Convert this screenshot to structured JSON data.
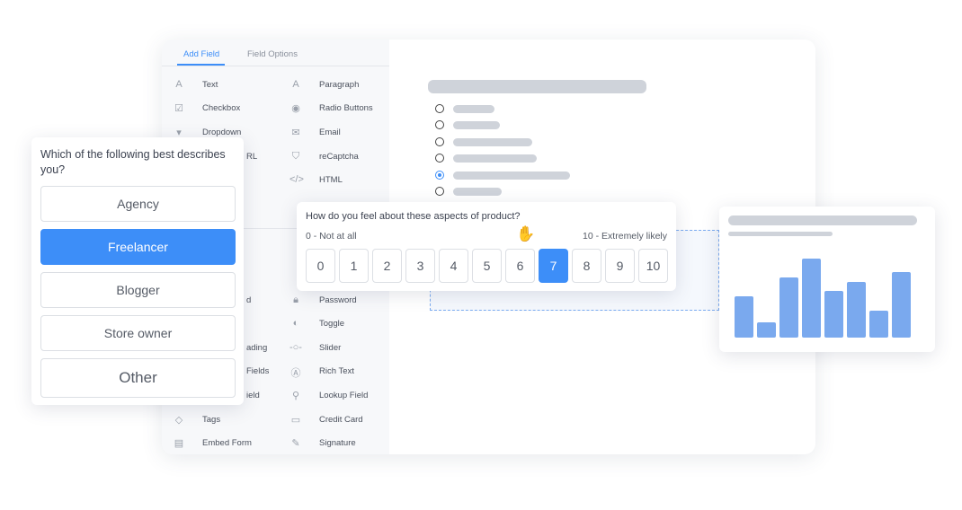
{
  "builder": {
    "tabs": [
      {
        "label": "Add Field",
        "active": true
      },
      {
        "label": "Field Options",
        "active": false
      }
    ],
    "left_fields": [
      {
        "label": "Text",
        "icon": "text-icon"
      },
      {
        "label": "Checkbox",
        "icon": "checkbox-icon"
      },
      {
        "label": "Dropdown",
        "icon": "dropdown-icon"
      },
      {
        "label": "RL"
      },
      {
        "label": "d"
      },
      {
        "label": "ading"
      },
      {
        "label": "Fields"
      },
      {
        "label": "ield"
      },
      {
        "label": "Tags",
        "icon": "tag-icon"
      },
      {
        "label": "Embed Form",
        "icon": "document-icon"
      }
    ],
    "right_fields": [
      {
        "label": "Paragraph",
        "icon": "paragraph-icon"
      },
      {
        "label": "Radio Buttons",
        "icon": "radio-icon"
      },
      {
        "label": "Email",
        "icon": "email-icon"
      },
      {
        "label": "reCaptcha",
        "icon": "shield-icon"
      },
      {
        "label": "HTML",
        "icon": "code-icon"
      },
      {
        "label": "Password",
        "icon": "lock-icon"
      },
      {
        "label": "Toggle",
        "icon": "toggle-icon"
      },
      {
        "label": "Slider",
        "icon": "slider-icon"
      },
      {
        "label": "Rich Text",
        "icon": "rich-text-icon"
      },
      {
        "label": "Lookup Field",
        "icon": "search-icon"
      },
      {
        "label": "Credit Card",
        "icon": "credit-card-icon"
      },
      {
        "label": "Signature",
        "icon": "pen-icon"
      }
    ],
    "preview_radio_selected_index": 4
  },
  "question_card": {
    "title": "Which of the following best describes you?",
    "options": [
      "Agency",
      "Freelancer",
      "Blogger",
      "Store owner",
      "Other"
    ],
    "selected": "Freelancer"
  },
  "rating_card": {
    "question": "How do you feel about these aspects of product?",
    "min_label": "0 - Not at all",
    "max_label": "10 - Extremely likely",
    "scale": [
      "0",
      "1",
      "2",
      "3",
      "4",
      "5",
      "6",
      "7",
      "8",
      "9",
      "10"
    ],
    "selected": "7"
  },
  "chart_data": {
    "type": "bar",
    "values": [
      46,
      17,
      67,
      88,
      52,
      62,
      30,
      73
    ],
    "color": "#7aa9ee"
  },
  "colors": {
    "accent": "#3d8ef8"
  }
}
